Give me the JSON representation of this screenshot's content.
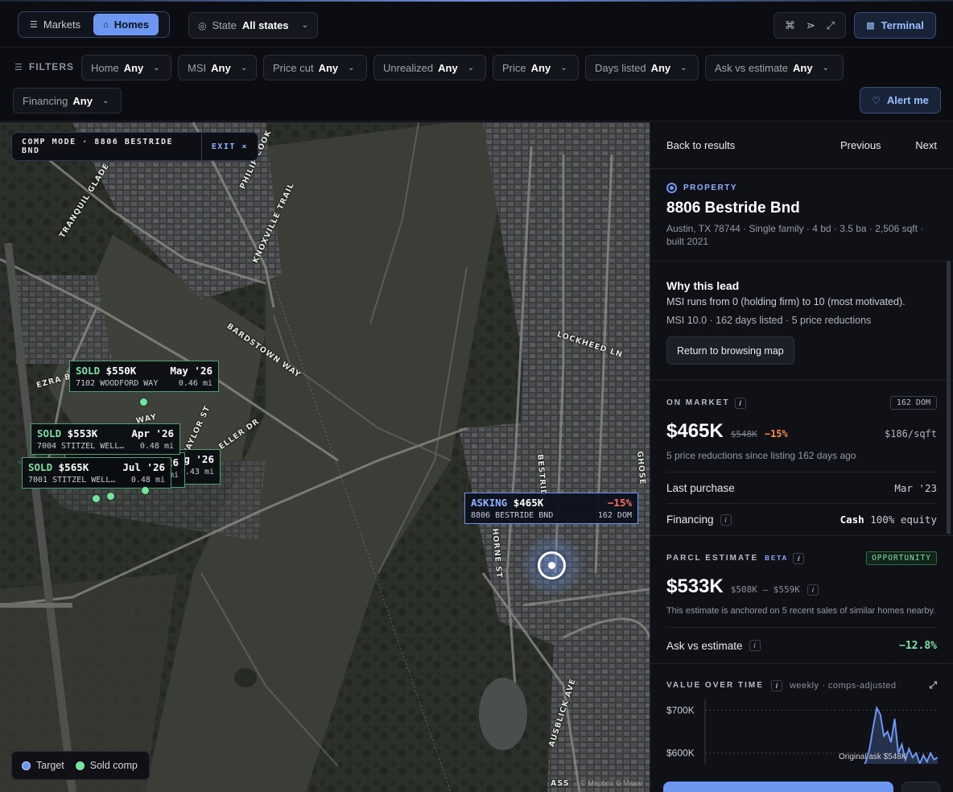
{
  "topbar": {
    "segments": [
      {
        "label": "Markets",
        "icon": "layers-icon"
      },
      {
        "label": "Homes",
        "icon": "home-icon"
      }
    ],
    "state_label": "State",
    "state_value": "All states",
    "terminal_label": "Terminal"
  },
  "filters": {
    "label": "FILTERS",
    "chips": [
      {
        "name": "Home",
        "value": "Any"
      },
      {
        "name": "MSI",
        "value": "Any"
      },
      {
        "name": "Price cut",
        "value": "Any"
      },
      {
        "name": "Unrealized",
        "value": "Any"
      },
      {
        "name": "Price",
        "value": "Any"
      },
      {
        "name": "Days listed",
        "value": "Any"
      },
      {
        "name": "Ask vs estimate",
        "value": "Any"
      },
      {
        "name": "Financing",
        "value": "Any"
      }
    ],
    "alert_label": "Alert me"
  },
  "map": {
    "comp_mode": "COMP MODE · 8806 BESTRIDE BND",
    "exit_label": "EXIT ×",
    "road_labels": [
      "TRANQUIL GLADE TRAIL",
      "KNOXVILLE TRAIL",
      "PHILIP COOK",
      "BARDSTOWN WAY",
      "LOCKHEED LN",
      "EZRA B",
      "TAYLOR ST",
      "ELLER DR",
      "BESTRIDE",
      "HORNE ST",
      "AUSBLICK AVE",
      "GHOSE",
      "WAY",
      "ASS"
    ],
    "comps": [
      {
        "status": "SOLD",
        "price": "$550K",
        "date": "May '26",
        "address": "7102 WOODFORD WAY",
        "distance": "0.46 mi"
      },
      {
        "status": "SOLD",
        "price": "$553K",
        "date": "Apr '26",
        "address": "7004 STITZEL WELL…",
        "distance": "0.48 mi"
      },
      {
        "status": "SOLD",
        "price": "",
        "date": "g '26",
        "address": "",
        "distance": "0.43 mi"
      },
      {
        "status": "SOLD",
        "price": "$565K",
        "date": "Jul '26",
        "address": "7001 STITZEL WELL…",
        "distance": "0.48 mi"
      }
    ],
    "behind_card": {
      "extra_date": "26",
      "extra_dist": "mi"
    },
    "target": {
      "status": "ASKING",
      "price": "$465K",
      "change": "−15%",
      "address": "8806 BESTRIDE BND",
      "dom": "162 DOM"
    },
    "legend": {
      "target": "Target",
      "sold": "Sold comp"
    },
    "attribution": "© Mapbox © Maxar",
    "colors": {
      "target": "#6d96f1",
      "sold": "#76e39f"
    }
  },
  "panel": {
    "nav": {
      "back": "Back to results",
      "prev": "Previous",
      "next": "Next"
    },
    "property": {
      "tag": "PROPERTY",
      "address": "8806 Bestride Bnd",
      "details_1": "Austin, TX 78744 · Single family · 4 bd · 3.5 ba · 2,506 sqft ·",
      "details_2": "built 2021"
    },
    "why": {
      "title": "Why this lead",
      "desc": "MSI runs from 0 (holding firm) to 10 (most motivated).",
      "meta": "MSI 10.0 · 162 days listed · 5 price reductions",
      "button": "Return to browsing map"
    },
    "market": {
      "header": "ON MARKET",
      "badge": "162 DOM",
      "price": "$465K",
      "original": "$548K",
      "change": "−15%",
      "psf": "$186/sqft",
      "note": "5 price reductions since listing 162 days ago",
      "last_purchase_label": "Last purchase",
      "last_purchase_value": "Mar '23",
      "financing_label": "Financing",
      "financing_value": "Cash",
      "financing_detail": "100% equity"
    },
    "estimate": {
      "header": "PARCL ESTIMATE",
      "beta": "BETA",
      "badge": "OPPORTUNITY",
      "price": "$533K",
      "range": "$508K – $559K",
      "note": "This estimate is anchored on 5 recent sales of similar homes nearby.",
      "ask_label": "Ask vs estimate",
      "ask_value": "−12.8%"
    },
    "vot": {
      "header": "VALUE OVER TIME",
      "qualifier": "weekly · comps-adjusted",
      "y_ticks": [
        "$700K",
        "$600K"
      ],
      "annotation": "Original ask $548K"
    }
  },
  "chart_data": {
    "type": "line",
    "title": "VALUE OVER TIME",
    "subtitle": "weekly · comps-adjusted",
    "y_ticks": [
      "$700K",
      "$600K"
    ],
    "ylim": [
      575,
      725
    ],
    "x": [
      0,
      1,
      2,
      3,
      4,
      5,
      6,
      7,
      8,
      9,
      10,
      11,
      12,
      13,
      14,
      15,
      16,
      17,
      18,
      19,
      20,
      21,
      22,
      23,
      24
    ],
    "series": [
      {
        "values": [
          560,
          560,
          560,
          565,
          580,
          610,
          660,
          705,
          690,
          640,
          650,
          625,
          680,
          600,
          620,
          585,
          610,
          590,
          600,
          575,
          595,
          580,
          600,
          585,
          590
        ]
      }
    ],
    "annotations": [
      "Original ask $548K"
    ]
  }
}
